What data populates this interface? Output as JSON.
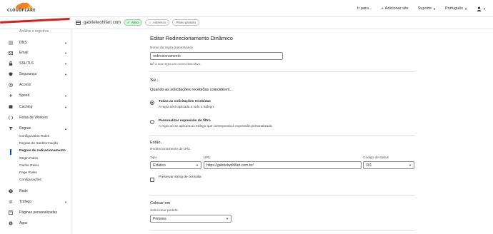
{
  "brand": {
    "name": "CLOUDFLARE",
    "accent": "#f48120",
    "accent_light": "#faad3f"
  },
  "topbar": {
    "goto_label": "Ir para...",
    "add_site_label": "Adicionar site",
    "support_label": "Suporte",
    "language_label": "Português",
    "user_icon": "user-icon"
  },
  "subbar": {
    "domain": "gabrielwohlfart.com",
    "status_active": "Ativo",
    "star_label": "Asterisco",
    "plan_label": "Plano gratuito"
  },
  "sidebar": {
    "truncated_top": "Análise e registros",
    "items": [
      {
        "label": "DNS",
        "icon": "dns-icon"
      },
      {
        "label": "Email",
        "icon": "email-icon"
      },
      {
        "label": "SSL/TLS",
        "icon": "lock-icon"
      },
      {
        "label": "Segurança",
        "icon": "shield-icon"
      },
      {
        "label": "Access",
        "icon": "access-icon"
      },
      {
        "label": "Speed",
        "icon": "speed-icon"
      },
      {
        "label": "Caching",
        "icon": "caching-icon"
      },
      {
        "label": "Rotas de Workers",
        "icon": "workers-icon"
      },
      {
        "label": "Regras",
        "icon": "rules-icon"
      },
      {
        "label": "Rede",
        "icon": "network-icon"
      },
      {
        "label": "Tráfego",
        "icon": "traffic-icon"
      },
      {
        "label": "Páginas personalizadas",
        "icon": "pages-icon"
      },
      {
        "label": "Apps",
        "icon": "apps-icon"
      }
    ],
    "rules_sub": [
      "Configuration Rules",
      "Regras de transformação",
      "Regras de redirecionamento",
      "Origin Rules",
      "Cache Rules",
      "Page Rules",
      "Configurações"
    ]
  },
  "form": {
    "title": "Editar Redirecionamento Dinâmico",
    "rule_name_label": "Nome da regra (necessário)",
    "rule_name_value": "redirecionamento",
    "rule_name_help": "Dê à sua regra um nome descritivo.",
    "if_heading": "Se...",
    "when_heading": "Quando as solicitações recebidas coincidirem...",
    "option_all_title": "Todas as solicitações recebidas",
    "option_all_desc": "A regra será aplicada a todo o tráfego",
    "option_custom_title": "Personalizar expressão do filtro",
    "option_custom_desc": "A regra só se aplicará ao tráfego que corresponda à expressão personalizada",
    "then_heading": "Então...",
    "url_redirect_label": "Redirecionamento de URL",
    "type_label": "Tipo",
    "type_value": "Estático",
    "url_label": "URL",
    "url_value": "https://gabrielwohlfart.com.br/",
    "status_label": "Código de status",
    "status_value": "301",
    "preserve_label": "Preservar string de consulta",
    "place_heading": "Colocar em",
    "select_order_label": "Selecionar pedido:",
    "order_value": "Primeira"
  }
}
